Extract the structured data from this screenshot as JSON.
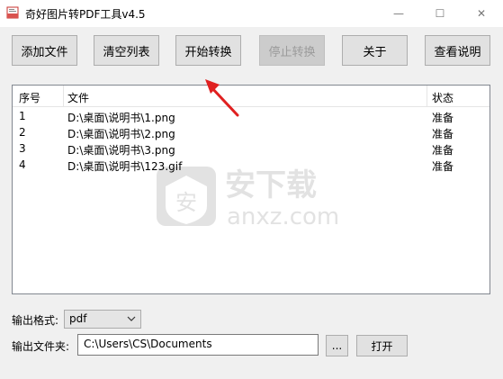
{
  "window": {
    "title": "奇好图片转PDF工具v4.5",
    "minimize_glyph": "—",
    "maximize_glyph": "☐",
    "close_glyph": "✕"
  },
  "toolbar": {
    "add_files": "添加文件",
    "clear_list": "清空列表",
    "start_convert": "开始转换",
    "stop_convert": "停止转换",
    "about": "关于",
    "view_help": "查看说明"
  },
  "table": {
    "headers": {
      "index": "序号",
      "file": "文件",
      "status": "状态"
    },
    "rows": [
      {
        "index": "1",
        "file": "D:\\桌面\\说明书\\1.png",
        "status": "准备"
      },
      {
        "index": "2",
        "file": "D:\\桌面\\说明书\\2.png",
        "status": "准备"
      },
      {
        "index": "3",
        "file": "D:\\桌面\\说明书\\3.png",
        "status": "准备"
      },
      {
        "index": "4",
        "file": "D:\\桌面\\说明书\\123.gif",
        "status": "准备"
      }
    ]
  },
  "output": {
    "format_label": "输出格式:",
    "format_value": "pdf",
    "folder_label": "输出文件夹:",
    "folder_value": "C:\\Users\\CS\\Documents",
    "browse_label": "...",
    "open_label": "打开"
  },
  "watermark": {
    "cn": "安下载",
    "en": "anxz.com",
    "badge": "安"
  },
  "colors": {
    "arrow": "#e02020",
    "accent": "#0078d7"
  }
}
